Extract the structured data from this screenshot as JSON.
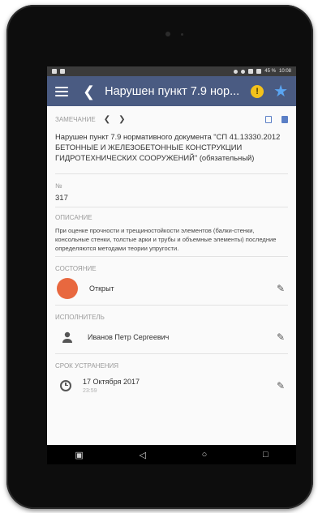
{
  "status_bar": {
    "time": "10:08",
    "battery": "45 %"
  },
  "app_bar": {
    "title": "Нарушен пункт 7.9 нор...",
    "back_icon": "chevron-left-icon",
    "menu_icon": "menu-icon",
    "warning_icon": "warning-icon",
    "star_icon": "star-icon",
    "colors": {
      "background": "#4a5b82",
      "warning": "#f4c21a",
      "star": "#5aa5f2"
    }
  },
  "remark": {
    "label": "ЗАМЕЧАНИЕ",
    "prev_icon": "chevron-left-icon",
    "next_icon": "chevron-right-icon",
    "text": "Нарушен пункт 7.9 нормативного документа \"СП 41.13330.2012 БЕТОННЫЕ И ЖЕЛЕЗОБЕТОННЫЕ КОНСТРУКЦИИ ГИДРОТЕХНИЧЕСКИХ СООРУЖЕНИЙ\" (обязательный)"
  },
  "number": {
    "label": "№",
    "value": "317"
  },
  "description": {
    "label": "ОПИСАНИЕ",
    "text": "При оценке прочности и трещиностойкости элементов (балки-стенки, консольные стенки, толстые арки и трубы и объемные элементы) последние определяются методами теории упругости."
  },
  "state": {
    "label": "СОСТОЯНИЕ",
    "value": "Открыт",
    "color": "#e8683f"
  },
  "executor": {
    "label": "ИСПОЛНИТЕЛЬ",
    "value": "Иванов Петр Сергеевич"
  },
  "deadline": {
    "label": "СРОК УСТРАНЕНИЯ",
    "date": "17 Октября 2017",
    "time": "23:59"
  },
  "nav_bar": {
    "items": [
      "recent-apps-icon",
      "back-icon",
      "home-icon",
      "overview-icon"
    ]
  }
}
